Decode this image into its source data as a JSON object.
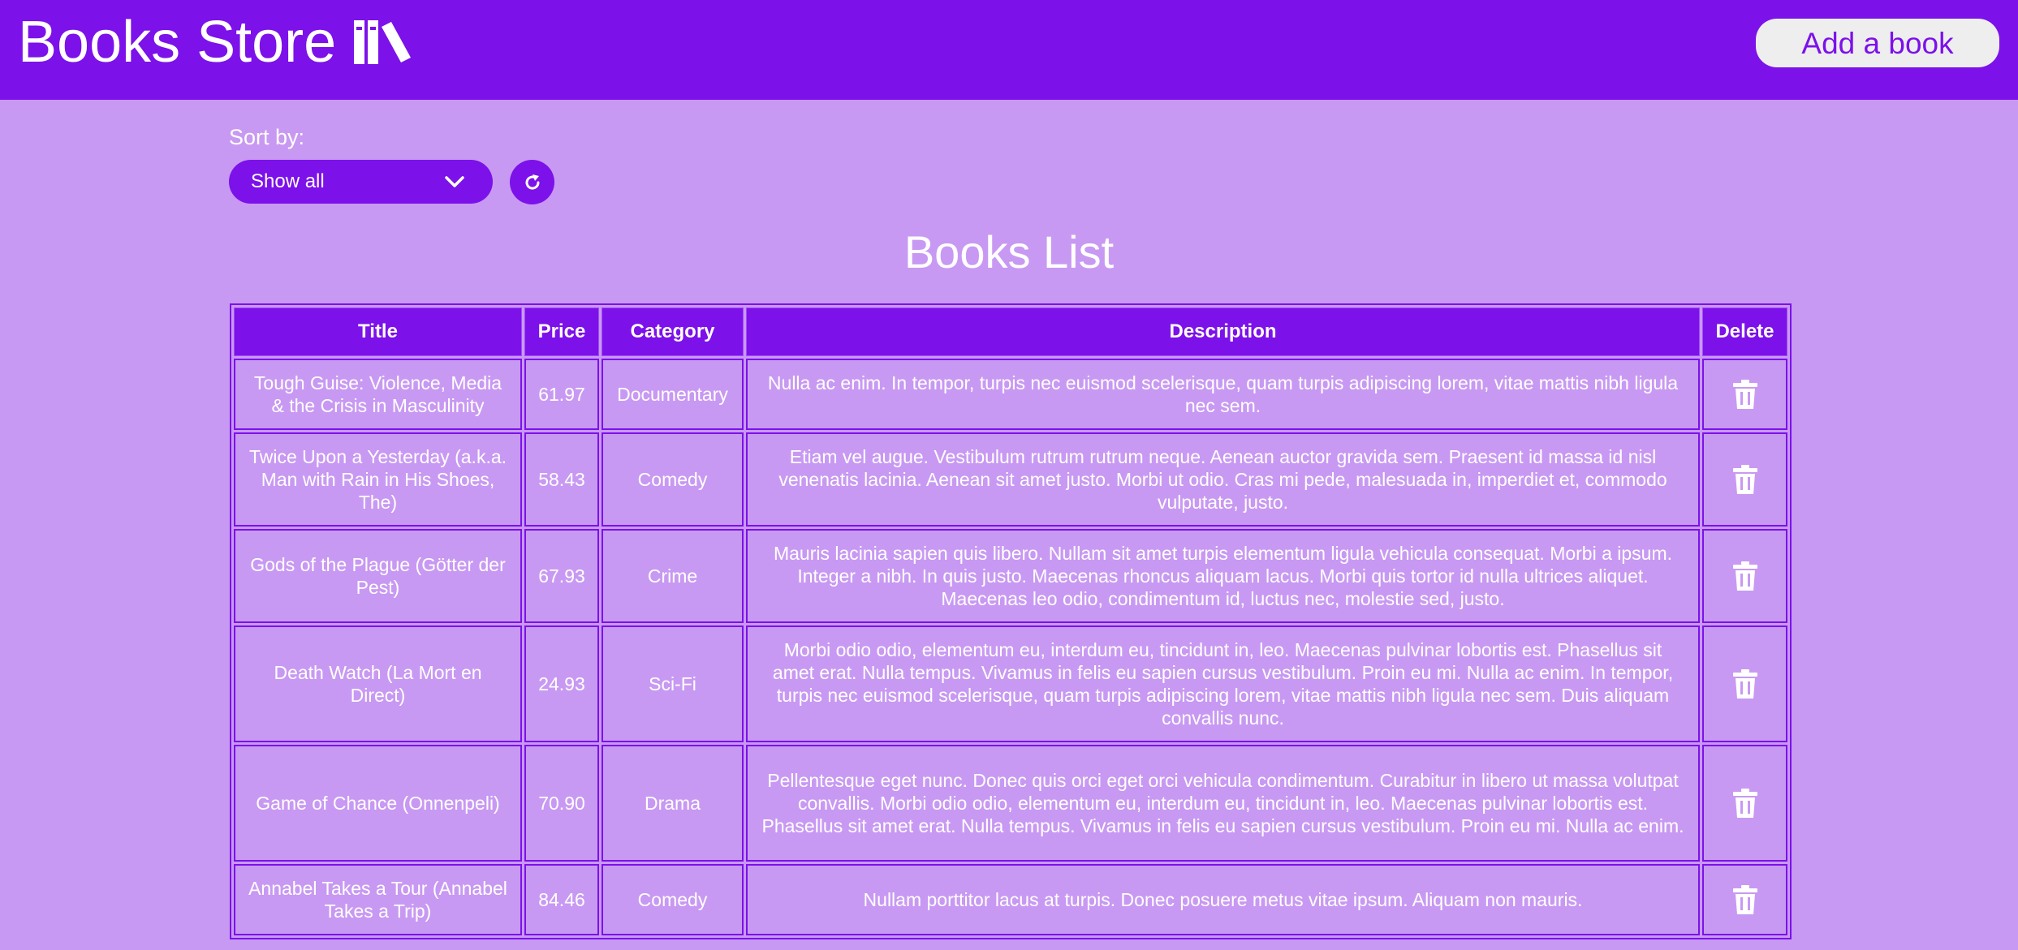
{
  "header": {
    "title": "Books Store",
    "logo_icon": "books-icon",
    "add_button_label": "Add a book"
  },
  "sort": {
    "label": "Sort by:",
    "selected": "Show all",
    "refresh_icon": "refresh-icon"
  },
  "list": {
    "title": "Books List",
    "columns": [
      "Title",
      "Price",
      "Category",
      "Description",
      "Delete"
    ],
    "rows": [
      {
        "title": "Tough Guise: Violence, Media & the Crisis in Masculinity",
        "price": "61.97",
        "category": "Documentary",
        "description": "Nulla ac enim. In tempor, turpis nec euismod scelerisque, quam turpis adipiscing lorem, vitae mattis nibh ligula nec sem."
      },
      {
        "title": "Twice Upon a Yesterday (a.k.a. Man with Rain in His Shoes, The)",
        "price": "58.43",
        "category": "Comedy",
        "description": "Etiam vel augue. Vestibulum rutrum rutrum neque. Aenean auctor gravida sem. Praesent id massa id nisl venenatis lacinia. Aenean sit amet justo. Morbi ut odio. Cras mi pede, malesuada in, imperdiet et, commodo vulputate, justo."
      },
      {
        "title": "Gods of the Plague (Götter der Pest)",
        "price": "67.93",
        "category": "Crime",
        "description": "Mauris lacinia sapien quis libero. Nullam sit amet turpis elementum ligula vehicula consequat. Morbi a ipsum. Integer a nibh. In quis justo. Maecenas rhoncus aliquam lacus. Morbi quis tortor id nulla ultrices aliquet. Maecenas leo odio, condimentum id, luctus nec, molestie sed, justo."
      },
      {
        "title": "Death Watch (La Mort en Direct)",
        "price": "24.93",
        "category": "Sci-Fi",
        "description": "Morbi odio odio, elementum eu, interdum eu, tincidunt in, leo. Maecenas pulvinar lobortis est. Phasellus sit amet erat. Nulla tempus. Vivamus in felis eu sapien cursus vestibulum. Proin eu mi. Nulla ac enim. In tempor, turpis nec euismod scelerisque, quam turpis adipiscing lorem, vitae mattis nibh ligula nec sem. Duis aliquam convallis nunc."
      },
      {
        "title": "Game of Chance (Onnenpeli)",
        "price": "70.90",
        "category": "Drama",
        "description": "Pellentesque eget nunc. Donec quis orci eget orci vehicula condimentum. Curabitur in libero ut massa volutpat convallis. Morbi odio odio, elementum eu, interdum eu, tincidunt in, leo. Maecenas pulvinar lobortis est. Phasellus sit amet erat. Nulla tempus. Vivamus in felis eu sapien cursus vestibulum. Proin eu mi. Nulla ac enim."
      },
      {
        "title": "Annabel Takes a Tour (Annabel Takes a Trip)",
        "price": "84.46",
        "category": "Comedy",
        "description": "Nullam porttitor lacus at turpis. Donec posuere metus vitae ipsum. Aliquam non mauris."
      }
    ],
    "delete_icon": "trash-icon"
  },
  "colors": {
    "primary": "#7c11ea",
    "background": "#c899f2",
    "button_bg": "#eeeeee",
    "text": "#ffffff"
  }
}
